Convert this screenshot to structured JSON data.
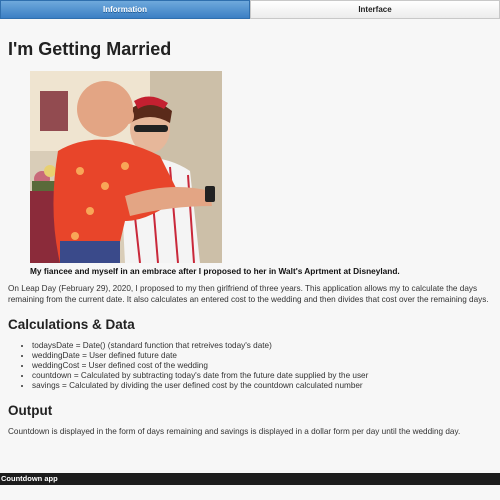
{
  "tabs": [
    {
      "label": "Information",
      "active": true
    },
    {
      "label": "Interface",
      "active": false
    }
  ],
  "page": {
    "title": "I'm Getting Married",
    "photo_caption": "My fiancee and myself in an embrace after I proposed to her in Walt's Aprtment at Disneyland.",
    "intro": "On Leap Day (February 29), 2020, I proposed to my then girlfriend of three years. This application allows my to calculate the days remaining from the current date. It also calculates an entered cost to the wedding and then divides that cost over the remaining days.",
    "calc_heading": "Calculations & Data",
    "calc_items": [
      "todaysDate = Date() (standard function that retreives today's date)",
      "weddingDate = User defined future date",
      "weddingCost = User defined cost of the wedding",
      "countdown = Calculated by subtracting today's date from the future date supplied by the user",
      "savings = Calculated by dividing the user defined cost by the countdown calculated number"
    ],
    "output_heading": "Output",
    "output_text": "Countdown is displayed in the form of days remaining and savings is displayed in a dollar form per day until the wedding day."
  },
  "footer": {
    "label": "Countdown app"
  },
  "colors": {
    "active_tab": "#3b7fc4",
    "footer_bg": "#1c1c1c"
  }
}
